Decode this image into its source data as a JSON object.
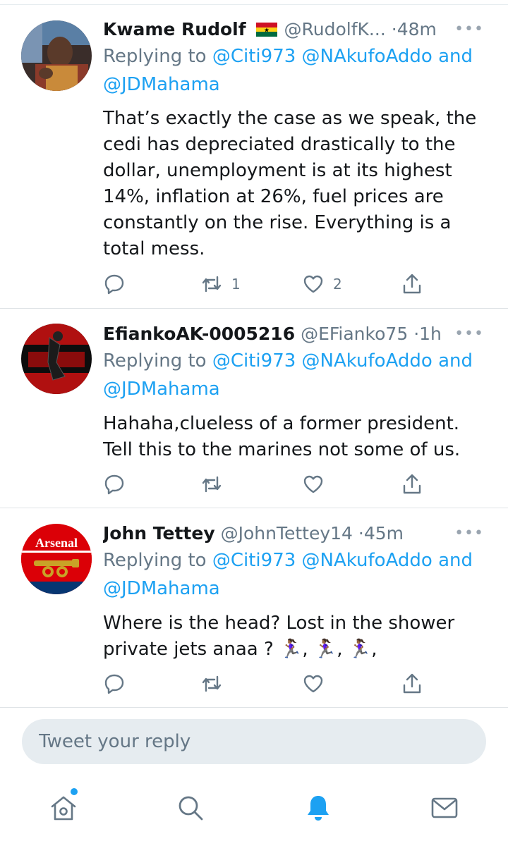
{
  "colors": {
    "accent": "#1da1f2",
    "secondary_text": "#657786",
    "primary_text": "#14171a"
  },
  "tweets": [
    {
      "name": "Kwame Rudolf",
      "flag_icon": "ghana-flag-icon",
      "handle": "@RudolfK...",
      "dot": "·",
      "time": "48m",
      "replying_prefix": "Replying to",
      "mentions": [
        "@Citi973",
        "@NAkufoAddo",
        "@JDMahama"
      ],
      "and_word": "and",
      "text_lines": [
        "That’s exactly the case as we speak, the",
        "cedi has depreciated drastically to the",
        "dollar, unemployment is at its highest",
        "14%, inflation at 26%, fuel prices are",
        "constantly on the rise. Everything is a",
        "total mess."
      ],
      "retweet_count": "1",
      "like_count": "2"
    },
    {
      "name": "EfiankoAK-0005216",
      "handle": "@EFianko75",
      "dot": "·",
      "time": "1h",
      "replying_prefix": "Replying to",
      "mentions": [
        "@Citi973",
        "@NAkufoAddo",
        "@JDMahama"
      ],
      "and_word": "and",
      "text_lines": [
        "Hahaha,clueless of a former president.",
        "Tell this to the marines not some of us."
      ],
      "retweet_count": "",
      "like_count": ""
    },
    {
      "name": "John Tettey",
      "handle": "@JohnTettey14",
      "dot": "·",
      "time": "45m",
      "replying_prefix": "Replying to",
      "mentions": [
        "@Citi973",
        "@NAkufoAddo",
        "@JDMahama"
      ],
      "and_word": "and",
      "text_lines": [
        "Where is the head? Lost in the shower",
        "private jets anaa ? 🏃🏾‍♀️, 🏃🏾‍♀️, 🏃🏾‍♀️,"
      ],
      "avatar_text": "Arsenal",
      "retweet_count": "",
      "like_count": ""
    }
  ],
  "more_glyph": "•••",
  "composer": {
    "placeholder": "Tweet your reply"
  },
  "tabbar": {
    "icons": [
      "home-icon",
      "search-icon",
      "notifications-bell-icon",
      "messages-envelope-icon"
    ]
  }
}
